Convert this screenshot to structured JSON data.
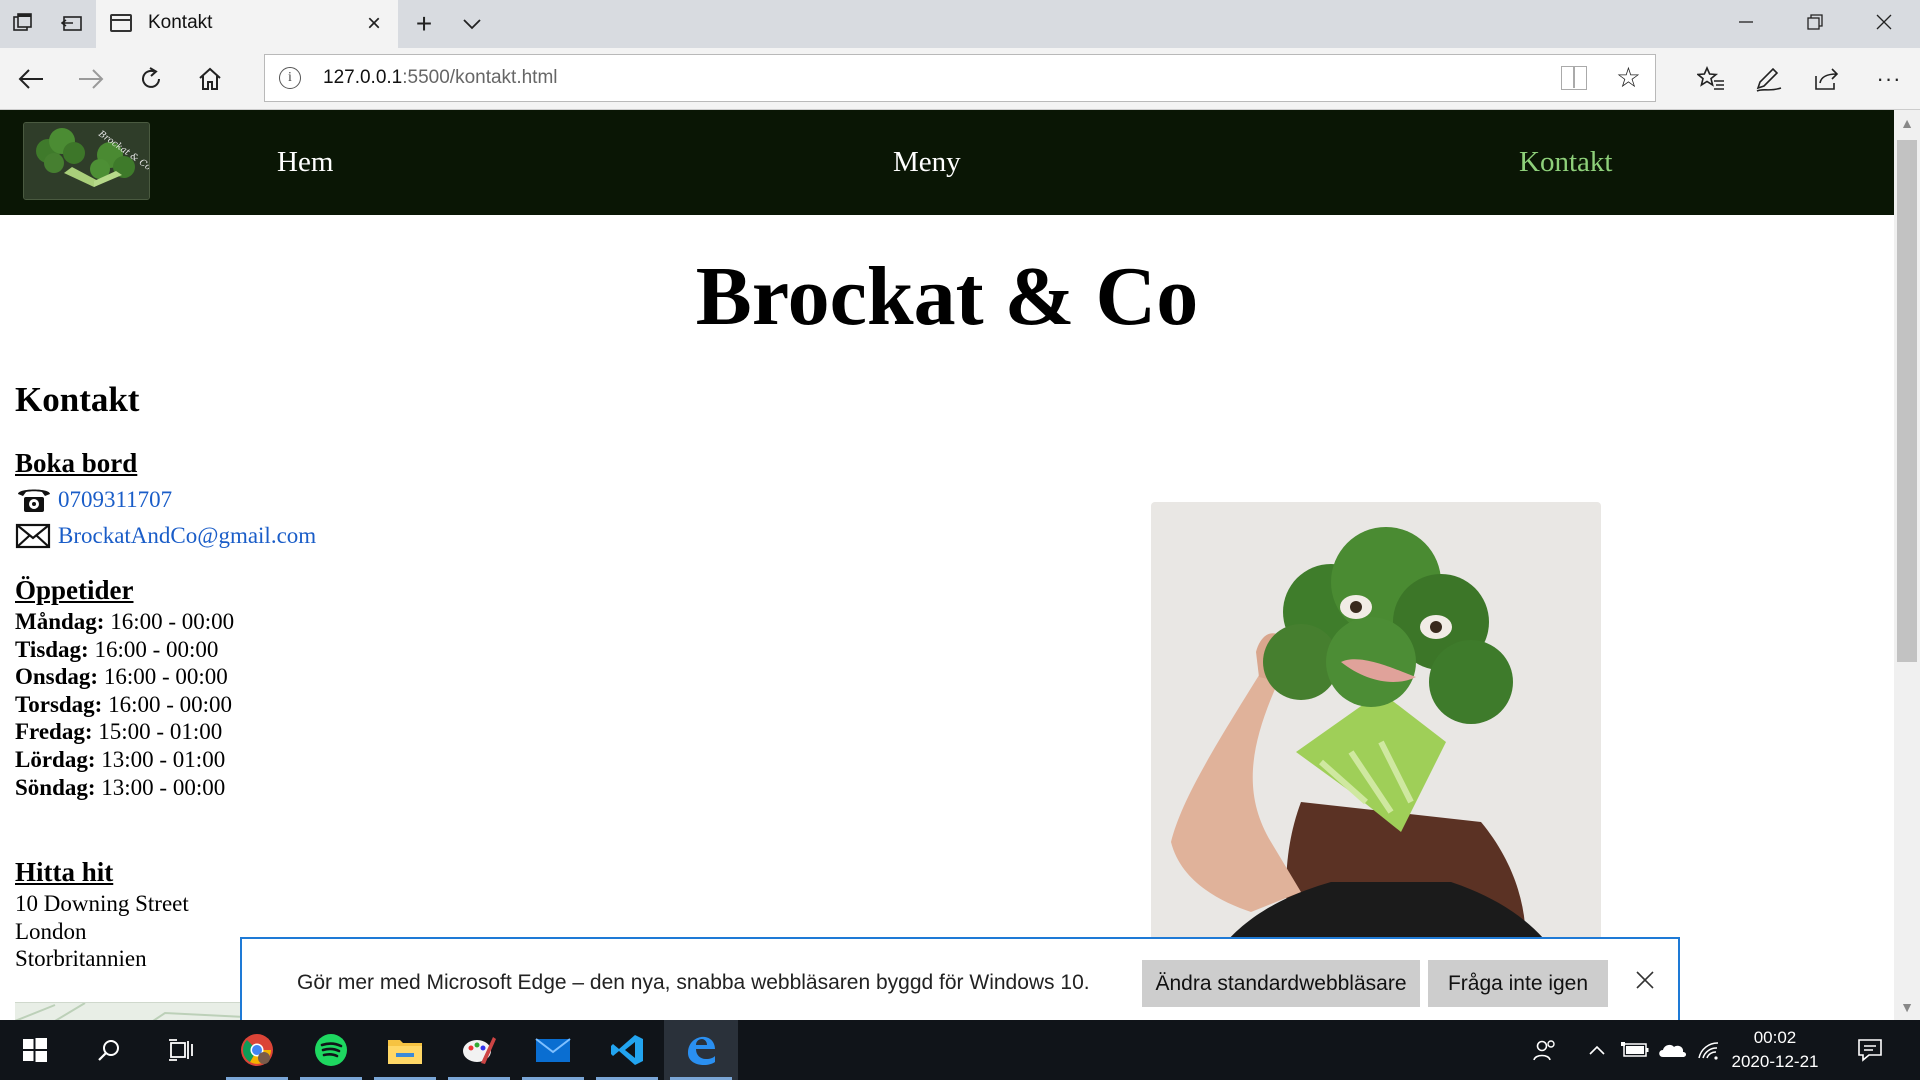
{
  "browser": {
    "tab_title": "Kontakt",
    "url_host": "127.0.0.1",
    "url_rest": ":5500/kontakt.html"
  },
  "site": {
    "logo_caption": "Brockat & Co",
    "nav": [
      "Hem",
      "Meny",
      "Kontakt"
    ],
    "active_nav": "Kontakt",
    "title": "Brockat & Co",
    "page_heading": "Kontakt",
    "accent_color": "#8ed07a",
    "nav_bg_color": "#0a1605",
    "link_color": "#1a5dc8"
  },
  "contact": {
    "heading": "Boka bord",
    "phone": "0709311707",
    "email": "BrockatAndCo@gmail.com",
    "phone_icon": "telephone-icon",
    "email_icon": "envelope-icon"
  },
  "hours": {
    "heading": "Öppetider",
    "days": [
      {
        "day": "Måndag:",
        "time": "16:00 - 00:00"
      },
      {
        "day": "Tisdag:",
        "time": "16:00 - 00:00"
      },
      {
        "day": "Onsdag:",
        "time": "16:00 - 00:00"
      },
      {
        "day": "Torsdag:",
        "time": "16:00 - 00:00"
      },
      {
        "day": "Fredag:",
        "time": "15:00 - 01:00"
      },
      {
        "day": "Lördag:",
        "time": "13:00 - 01:00"
      },
      {
        "day": "Söndag:",
        "time": "13:00 - 00:00"
      }
    ]
  },
  "location": {
    "heading": "Hitta hit",
    "lines": [
      "10 Downing Street",
      "London",
      "Storbritannien"
    ]
  },
  "edge_prompt": {
    "message": "Gör mer med Microsoft Edge – den nya, snabba webbläsaren byggd för Windows 10.",
    "primary_button": "Ändra standardwebbläsare",
    "secondary_button": "Fråga inte igen",
    "border_color": "#1e7ad6"
  },
  "taskbar": {
    "apps": [
      "chrome-icon",
      "spotify-icon",
      "file-explorer-icon",
      "paint-icon",
      "mail-icon",
      "vscode-icon",
      "edge-icon"
    ],
    "time": "00:02",
    "date": "2020-12-21"
  }
}
